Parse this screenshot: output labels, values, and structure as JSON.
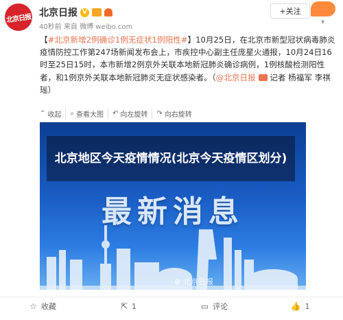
{
  "header": {
    "avatar_text": "北京日报",
    "user_name": "北京日报",
    "meta": "40秒前 来自 微博 weibo.com",
    "follow_label": "+关注"
  },
  "post": {
    "hashtag": "#北京新增2例确诊1例无症状1例阳性#",
    "body": "】10月25日，在北京市新型冠状病毒肺炎疫情防控工作第247场新闻发布会上，市疾控中心副主任庞星火通报，10月24日16时至25日15时，本市新增2例京外关联本地新冠肺炎确诊病例，1例核酸检测阳性者，和1例京外关联本地新冠肺炎无症状感染者。（",
    "mention": "@北京日报",
    "tail": " 记者 杨福军 李祺瑶）"
  },
  "actions": {
    "collapse": "收起",
    "view_large": "查看大图",
    "rotate_left": "向左旋转",
    "rotate_right": "向右旋转"
  },
  "article": {
    "overlay_title": "北京地区今天疫情情况(北京今天疫情区划分)",
    "big_title": "最新消息",
    "watermark": "⊕ 北京日报"
  },
  "footer": {
    "favorite": "收藏",
    "repost_count": "1",
    "comment": "评论",
    "like_count": "1"
  }
}
